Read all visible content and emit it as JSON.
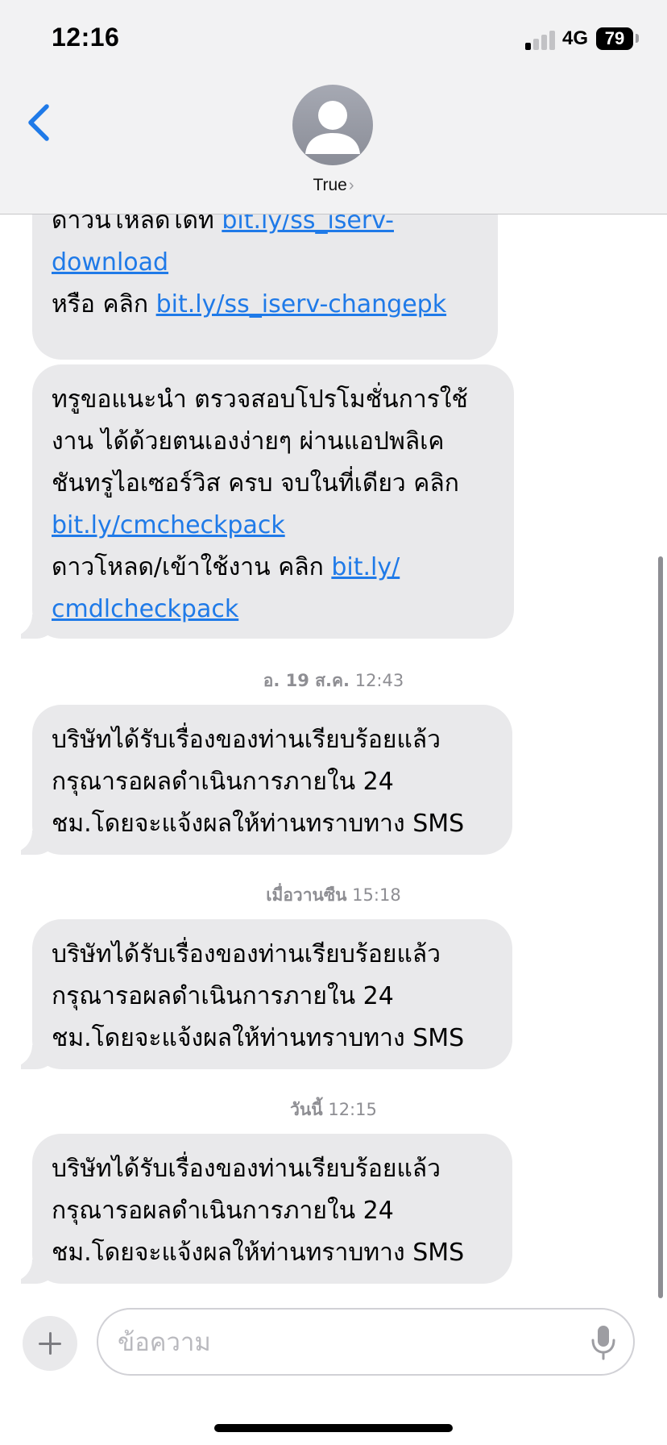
{
  "status_bar": {
    "time": "12:16",
    "network": "4G",
    "battery": "79"
  },
  "header": {
    "contact_name": "True",
    "back_icon": "chevron-left-icon",
    "avatar_icon": "person-silhouette-icon",
    "accent_color": "#1f7ae8"
  },
  "messages": [
    {
      "partial_top": true,
      "lines": [
        [
          {
            "t": "ดาวน์โหลดได้ที่ "
          },
          {
            "link": "bit.ly/ss_iserv-"
          }
        ],
        [
          {
            "link": "download"
          }
        ],
        [
          {
            "t": "หรือ คลิก "
          },
          {
            "link": "bit.ly/ss_iserv-changepk"
          }
        ]
      ]
    },
    {
      "lines": [
        [
          {
            "t": "ทรูขอแนะนำ ตรวจสอบโปรโมชั่นการใช้"
          }
        ],
        [
          {
            "t": "งาน ได้ด้วยตนเองง่ายๆ ผ่านแอปพลิเค"
          }
        ],
        [
          {
            "t": "ชันทรูไอเซอร์วิส ครบ จบในที่เดียว คลิก"
          }
        ],
        [
          {
            "link": "bit.ly/cmcheckpack"
          }
        ],
        [
          {
            "t": "ดาวโหลด/เข้าใช้งาน คลิก "
          },
          {
            "link": "bit.ly/"
          }
        ],
        [
          {
            "link": "cmdlcheckpack"
          }
        ]
      ]
    },
    {
      "stamp_day": "อ. 19 ส.ค.",
      "stamp_time": "12:43",
      "lines": [
        [
          {
            "t": "บริษัทได้รับเรื่องของท่านเรียบร้อยแล้ว"
          }
        ],
        [
          {
            "t": "กรุณารอผลดำเนินการภายใน 24"
          }
        ],
        [
          {
            "t": "ชม.โดยจะแจ้งผลให้ท่านทราบทาง SMS"
          }
        ]
      ]
    },
    {
      "stamp_day": "เมื่อวานซืน",
      "stamp_time": "15:18",
      "lines": [
        [
          {
            "t": "บริษัทได้รับเรื่องของท่านเรียบร้อยแล้ว"
          }
        ],
        [
          {
            "t": "กรุณารอผลดำเนินการภายใน 24"
          }
        ],
        [
          {
            "t": "ชม.โดยจะแจ้งผลให้ท่านทราบทาง SMS"
          }
        ]
      ]
    },
    {
      "stamp_day": "วันนี้",
      "stamp_time": "12:15",
      "lines": [
        [
          {
            "t": "บริษัทได้รับเรื่องของท่านเรียบร้อยแล้ว"
          }
        ],
        [
          {
            "t": "กรุณารอผลดำเนินการภายใน 24"
          }
        ],
        [
          {
            "t": "ชม.โดยจะแจ้งผลให้ท่านทราบทาง SMS"
          }
        ]
      ]
    }
  ],
  "composer": {
    "placeholder": "ข้อความ",
    "value": "",
    "plus_icon": "plus-icon",
    "mic_icon": "microphone-icon"
  }
}
